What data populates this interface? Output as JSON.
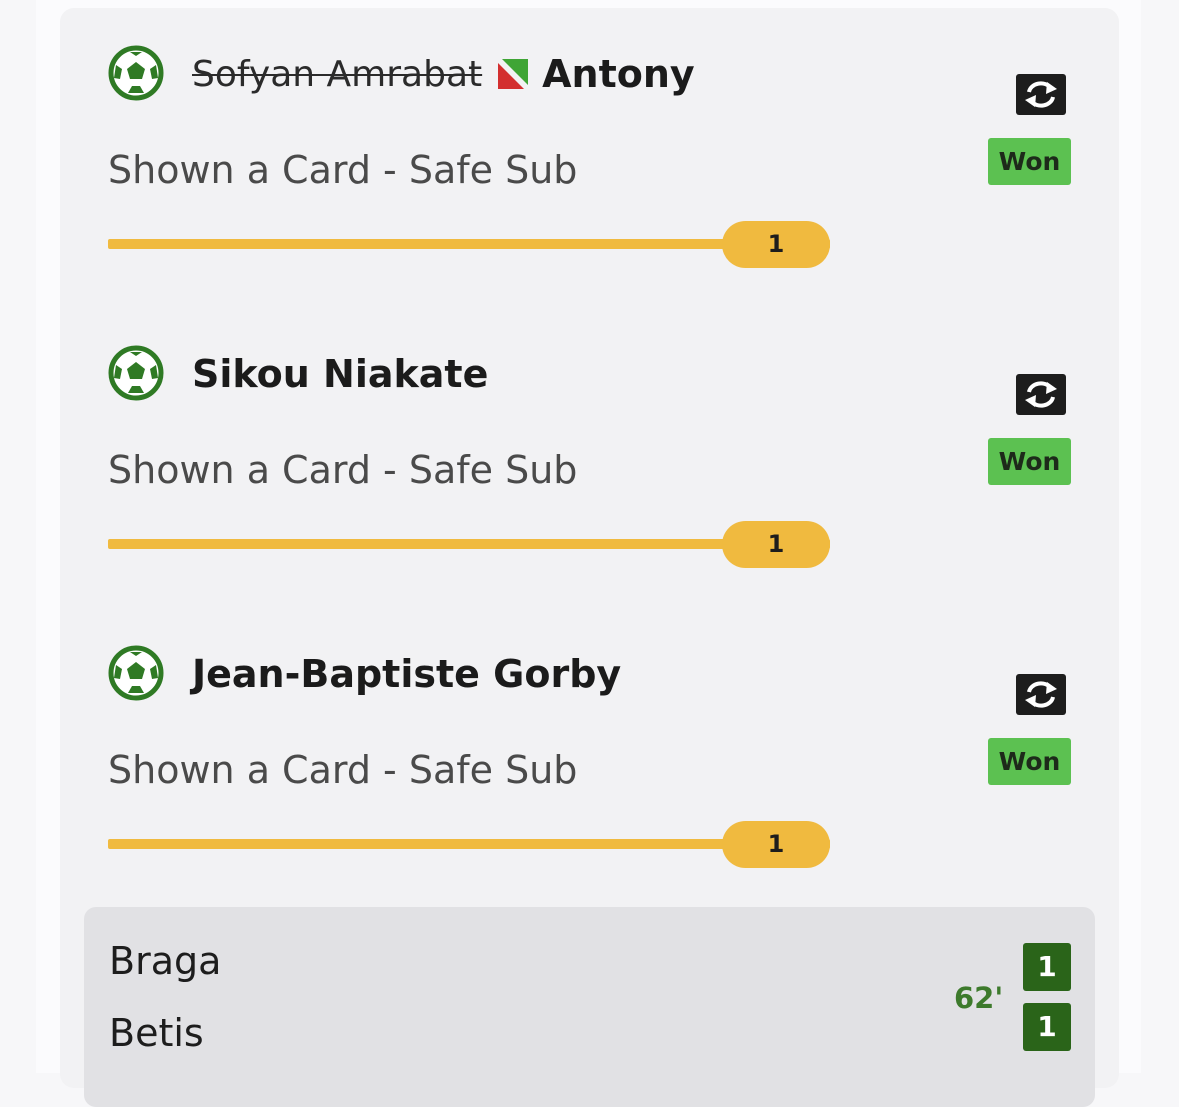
{
  "selections": [
    {
      "replaced_player": "Sofyan Amrabat",
      "player": "Antony",
      "market": "Shown a Card - Safe Sub",
      "status": "Won",
      "progress_value": "1",
      "progress_fraction": 1.0
    },
    {
      "replaced_player": "",
      "player": "Sikou Niakate",
      "market": "Shown a Card - Safe Sub",
      "status": "Won",
      "progress_value": "1",
      "progress_fraction": 1.0
    },
    {
      "replaced_player": "",
      "player": "Jean-Baptiste Gorby",
      "market": "Shown a Card - Safe Sub",
      "status": "Won",
      "progress_value": "1",
      "progress_fraction": 1.0
    }
  ],
  "scoreboard": {
    "home_team": "Braga",
    "away_team": "Betis",
    "home_score": "1",
    "away_score": "1",
    "minute": "62'"
  },
  "icons": {
    "ball": "football-icon",
    "substitution": "substitution-swap-icon",
    "swap_flag": "substitution-arrow-icon"
  },
  "colors": {
    "won_badge": "#5cc151",
    "progress": "#f0ba3f",
    "ball_green": "#2f7a24",
    "score_box": "#2a6419",
    "minute": "#3d7a2c",
    "swap_red": "#d32f2f",
    "swap_green": "#3fa535"
  }
}
